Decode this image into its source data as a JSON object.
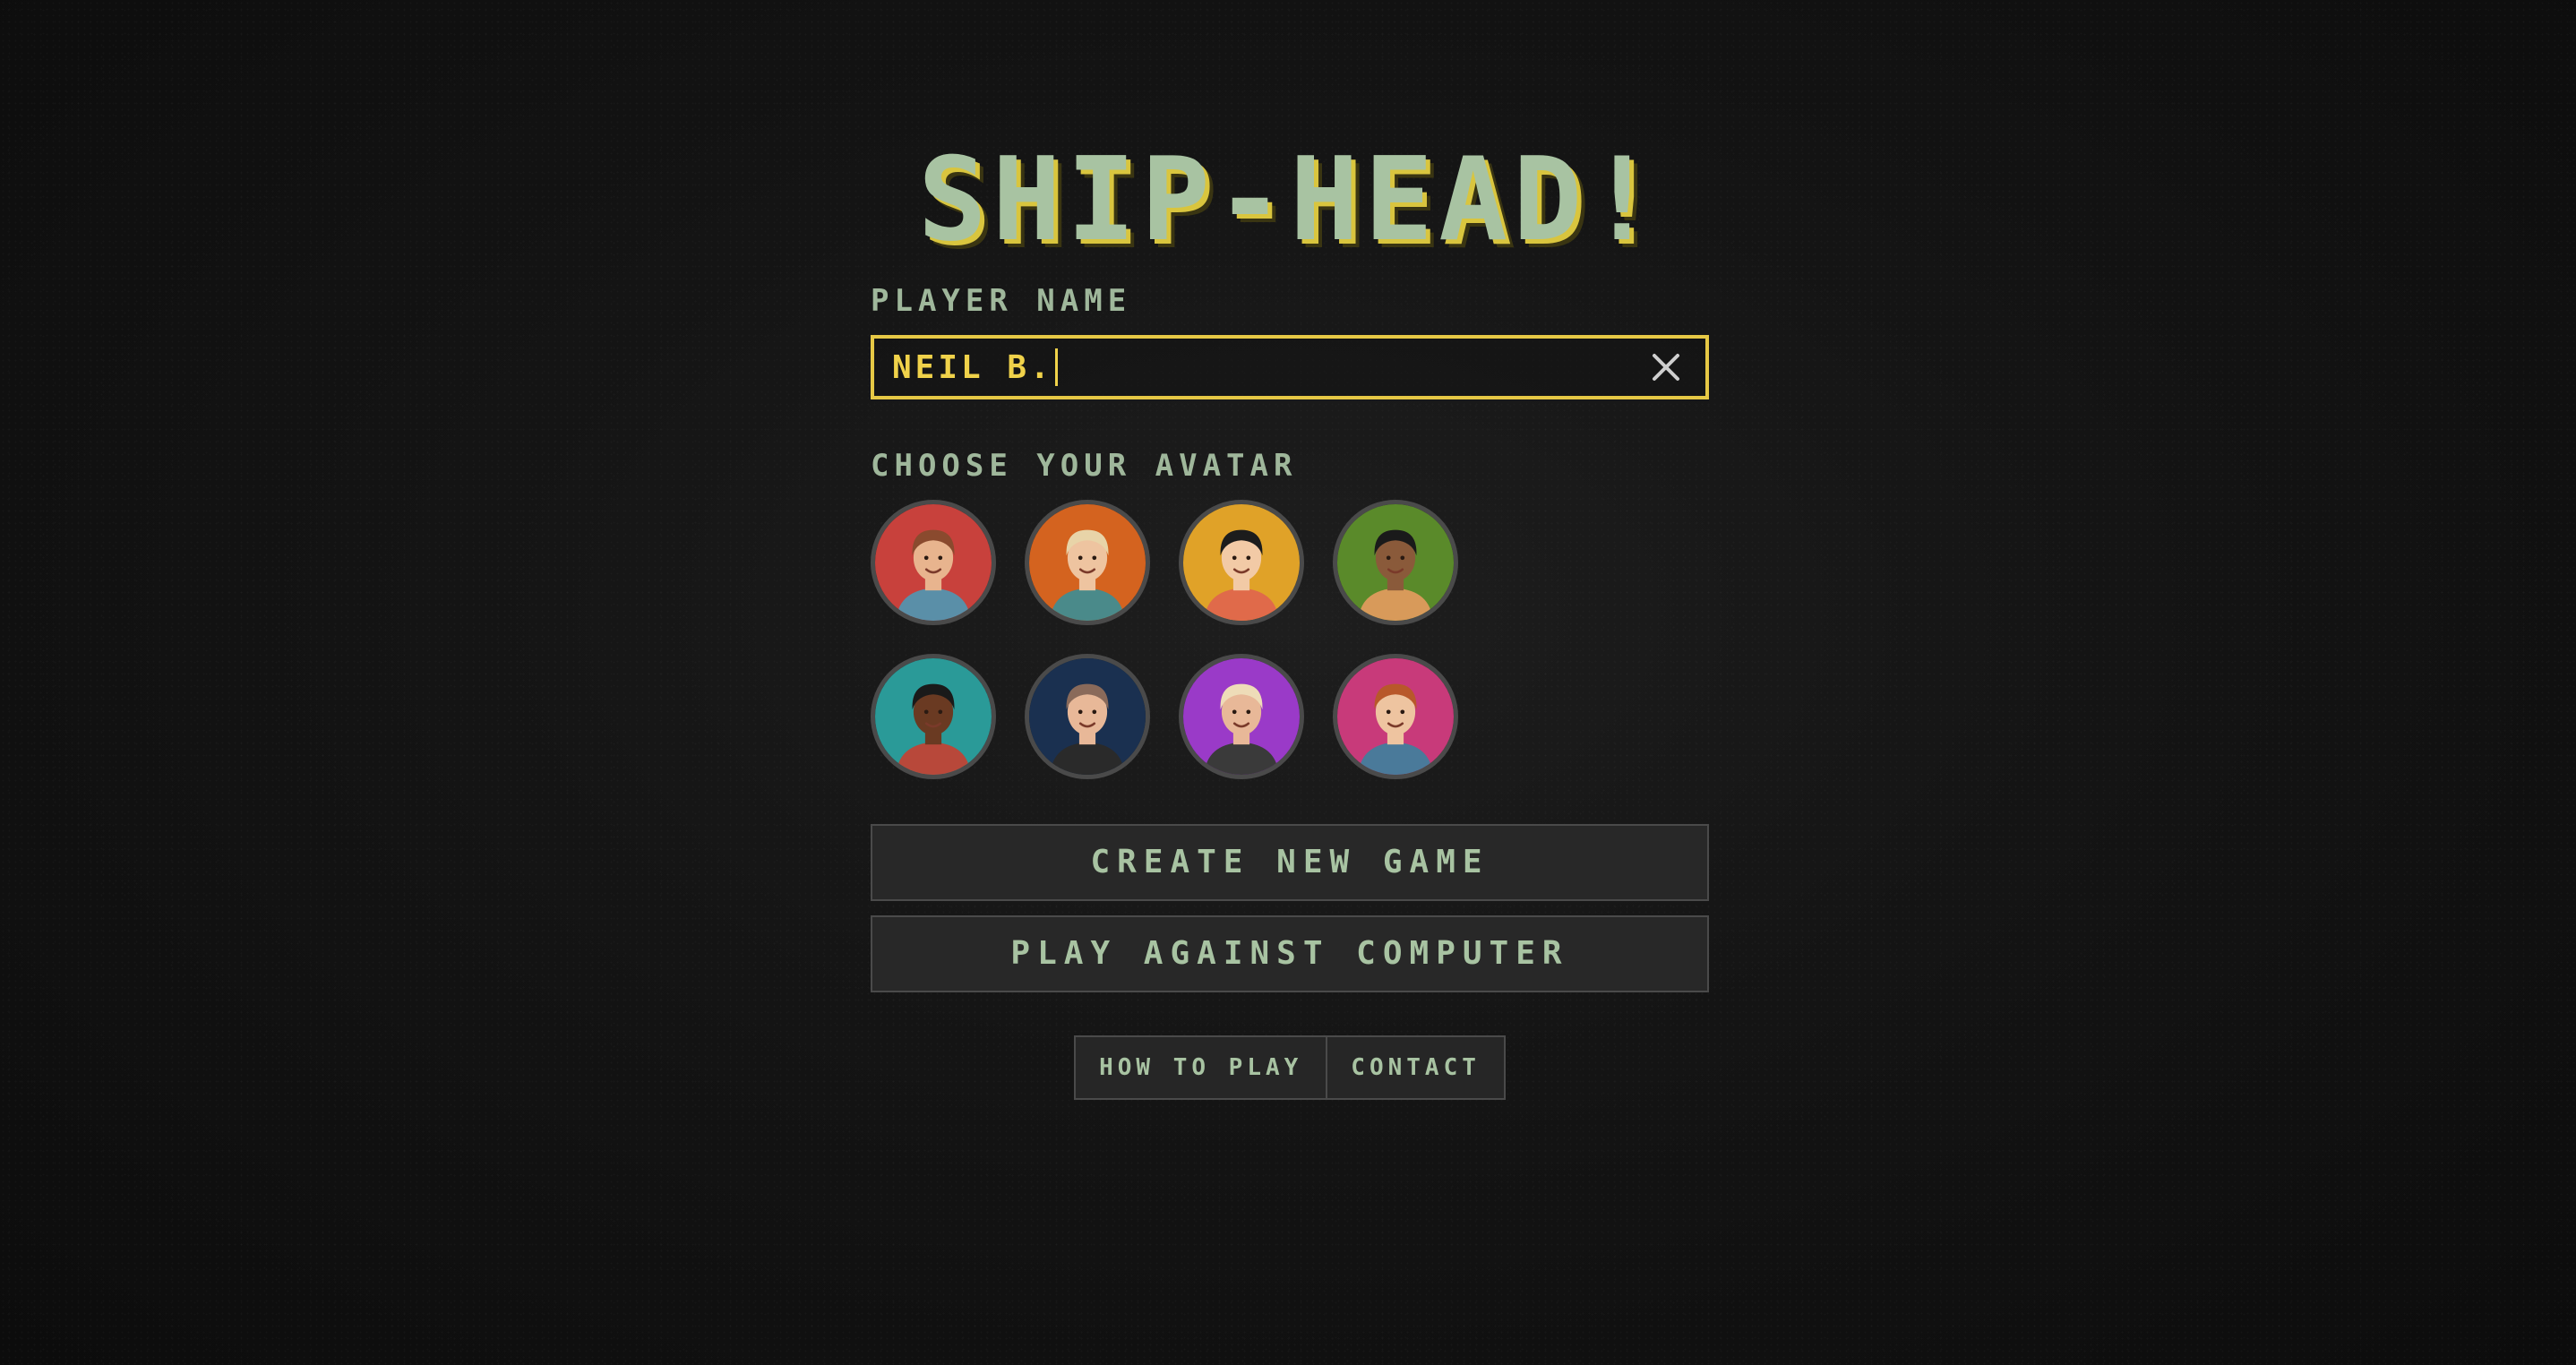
{
  "title": "SHIP-HEAD!",
  "player_name": {
    "label": "PLAYER NAME",
    "value": "NEIL B.",
    "clear_icon": "close-icon"
  },
  "avatar_section": {
    "label": "CHOOSE YOUR AVATAR",
    "avatars": [
      {
        "bg": "#c8413c",
        "skin": "#e8b48e",
        "hair": "#8a4a2e",
        "shirt": "#5a8fa8"
      },
      {
        "bg": "#d4631f",
        "skin": "#eec4a0",
        "hair": "#e8d4a8",
        "shirt": "#4a8a8a"
      },
      {
        "bg": "#e0a228",
        "skin": "#f2caa6",
        "hair": "#1c1c1c",
        "shirt": "#e06a4a"
      },
      {
        "bg": "#5a8a2a",
        "skin": "#8a5a3a",
        "hair": "#1a1a1a",
        "shirt": "#d89a5a"
      },
      {
        "bg": "#2a9a98",
        "skin": "#6a3a22",
        "hair": "#1a1a1a",
        "shirt": "#b8483a"
      },
      {
        "bg": "#1a3050",
        "skin": "#e8b898",
        "hair": "#8a6a5a",
        "shirt": "#2a2a2a"
      },
      {
        "bg": "#9a3ac8",
        "skin": "#e8b898",
        "hair": "#eedcb8",
        "shirt": "#3a3a3a"
      },
      {
        "bg": "#c83a7a",
        "skin": "#eec4a0",
        "hair": "#b8582a",
        "shirt": "#4a7a9a"
      }
    ]
  },
  "buttons": {
    "create": "CREATE NEW GAME",
    "computer": "PLAY AGAINST COMPUTER"
  },
  "footer": {
    "how_to_play": "HOW TO PLAY",
    "contact": "CONTACT"
  },
  "colors": {
    "accent": "#e6c845",
    "text": "#a8c3a2",
    "background": "#141414"
  }
}
